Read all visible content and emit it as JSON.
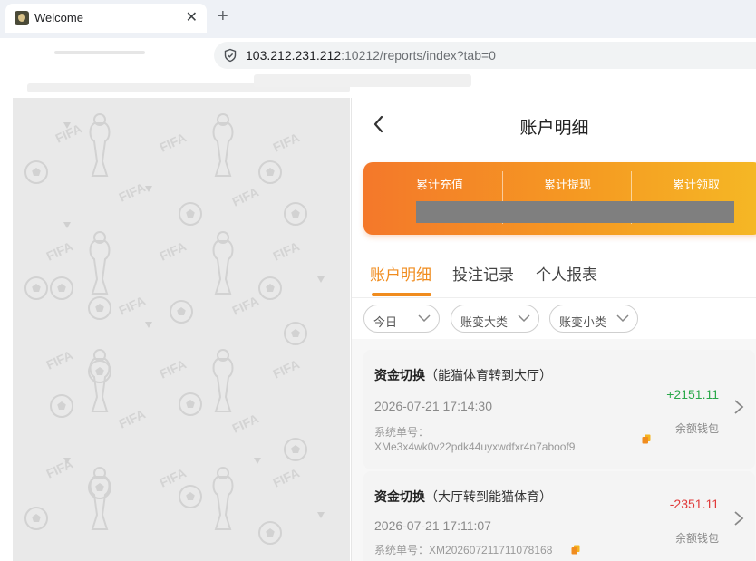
{
  "browser": {
    "tab_title": "Welcome",
    "tab_close": "✕",
    "new_tab": "+",
    "url_host": "103.212.231.212",
    "url_rest": ":10212/reports/index?tab=0"
  },
  "app": {
    "title": "账户明细",
    "summary": {
      "labels": [
        "累计充值",
        "累计提现",
        "累计领取"
      ],
      "gradient": [
        "#f4782a",
        "#f5b825"
      ]
    },
    "tabs": [
      {
        "label": "账户明细",
        "active": true
      },
      {
        "label": "投注记录",
        "active": false
      },
      {
        "label": "个人报表",
        "active": false
      }
    ],
    "filters": [
      "今日",
      "账变大类",
      "账变小类"
    ],
    "records": [
      {
        "title": "资金切换",
        "subtitle": "（能猫体育转到大厅）",
        "time": "2026-07-21 17:14:30",
        "order_label": "系统单号：",
        "order_no": "XMe3x4wk0v22pdk44uyxwdfxr4n7aboof9",
        "amount": "+2151.11",
        "wallet": "余额钱包"
      },
      {
        "title": "资金切换",
        "subtitle": "（大厅转到能猫体育）",
        "time": "2026-07-21 17:11:07",
        "order_label": "系统单号：",
        "order_no": "XM202607211711078168",
        "amount": "-2351.11",
        "wallet": "余额钱包"
      }
    ],
    "colors": {
      "accent": "#f08c1e",
      "positive": "#2aa84a",
      "negative": "#e03a3a"
    }
  }
}
